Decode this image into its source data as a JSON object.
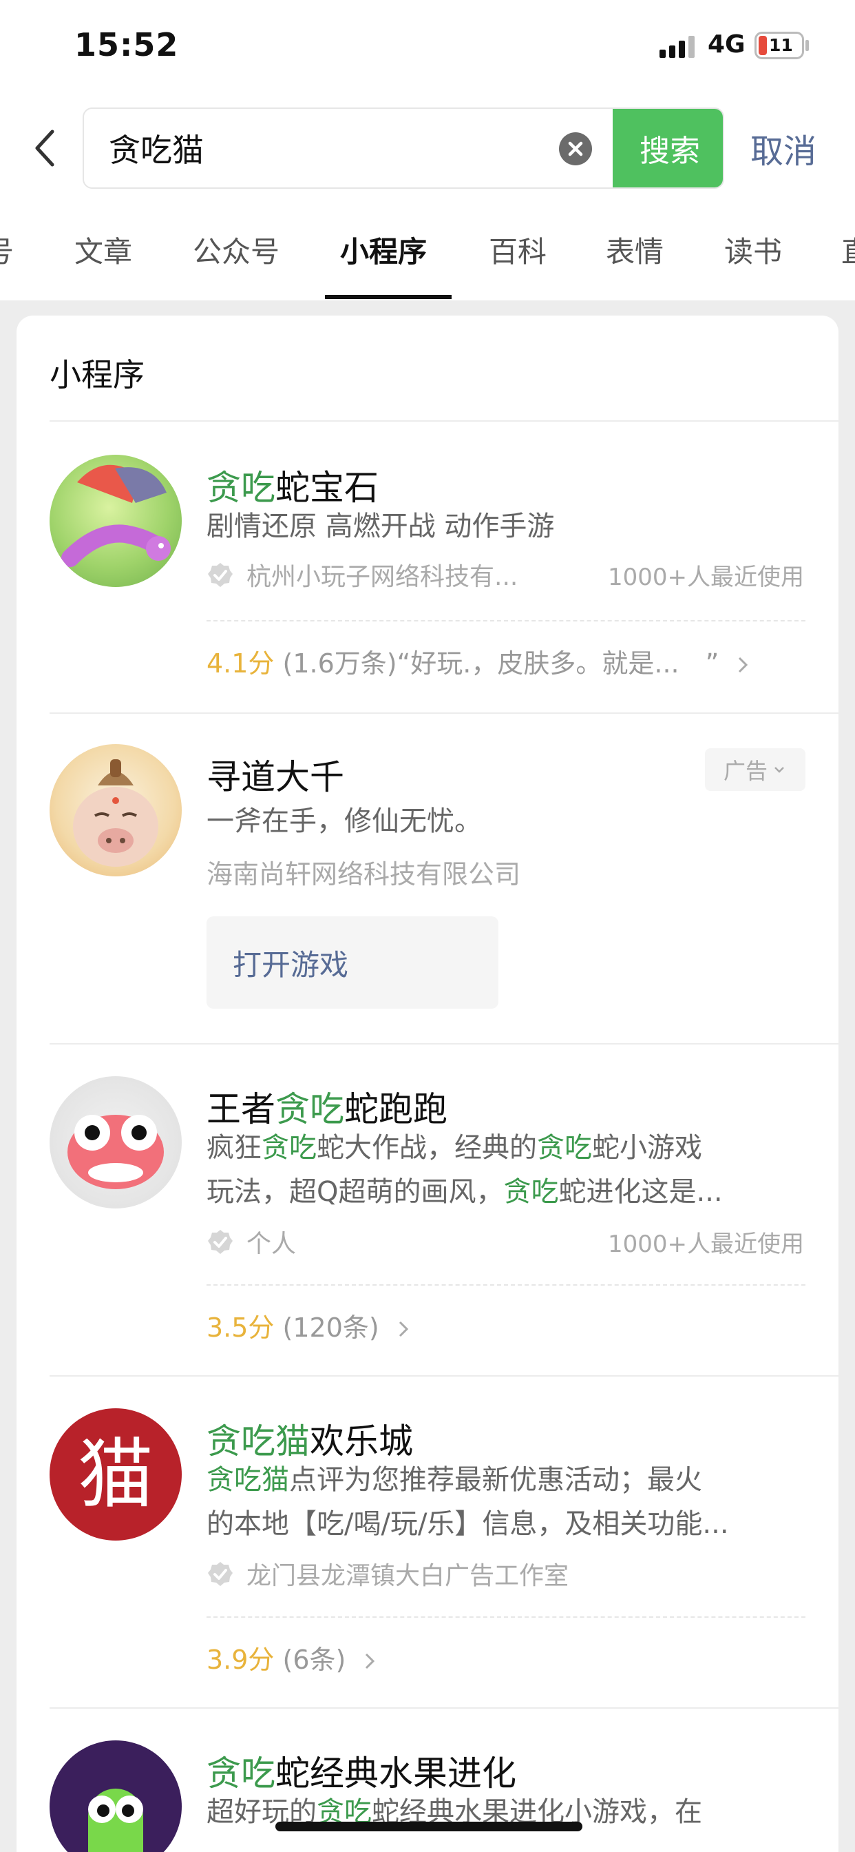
{
  "status_bar": {
    "time": "15:52",
    "network": "4G",
    "battery": "11"
  },
  "search": {
    "value": "贪吃猫",
    "button_label": "搜索",
    "cancel_label": "取消"
  },
  "tabs": [
    "号",
    "文章",
    "公众号",
    "小程序",
    "百科",
    "表情",
    "读书",
    "直"
  ],
  "active_tab": "小程序",
  "section_title": "小程序",
  "results": [
    {
      "name_hl": "贪吃",
      "name_rest": "蛇宝石",
      "description": "剧情还原 高燃开战 动作手游",
      "developer": "杭州小玩子网络科技有...",
      "usage": "1000+人最近使用",
      "score": "4.1分",
      "reviews": "(1.6万条)",
      "quote": "“好玩.，皮肤多。就是...　”"
    },
    {
      "name": "寻道大千",
      "ad_label": "广告",
      "description": "一斧在手，修仙无忧。",
      "developer": "海南尚轩网络科技有限公司",
      "button": "打开游戏"
    },
    {
      "name_pre": "王者",
      "name_hl": "贪吃",
      "name_rest": "蛇跑跑",
      "desc1_a": "疯狂",
      "desc1_b": "贪吃",
      "desc1_c": "蛇大作战，经典的",
      "desc1_d": "贪吃",
      "desc1_e": "蛇小游戏",
      "desc2_a": "玩法，超Q超萌的画风，",
      "desc2_b": "贪吃",
      "desc2_c": "蛇进化这是...",
      "developer": "个人",
      "usage": "1000+人最近使用",
      "score": "3.5分",
      "reviews": "(120条)"
    },
    {
      "name_hl": "贪吃猫",
      "name_rest": "欢乐城",
      "avatar_char": "猫",
      "desc1_a": "贪吃猫",
      "desc1_b": "点评为您推荐最新优惠活动；最火",
      "desc2": "的本地【吃/喝/玩/乐】信息，及相关功能...",
      "developer": "龙门县龙潭镇大白广告工作室",
      "score": "3.9分",
      "reviews": "(6条)"
    },
    {
      "name_hl": "贪吃",
      "name_rest": "蛇经典水果进化",
      "desc_a": "超好玩的",
      "desc_b": "贪吃",
      "desc_c": "蛇经典水果进化小游戏，在"
    }
  ],
  "colors": {
    "accent_green": "#4fc15f",
    "highlight": "#3c9a4d",
    "link_blue": "#576b95",
    "score_yellow": "#e8b33b",
    "battery_red": "#e64b3c"
  }
}
